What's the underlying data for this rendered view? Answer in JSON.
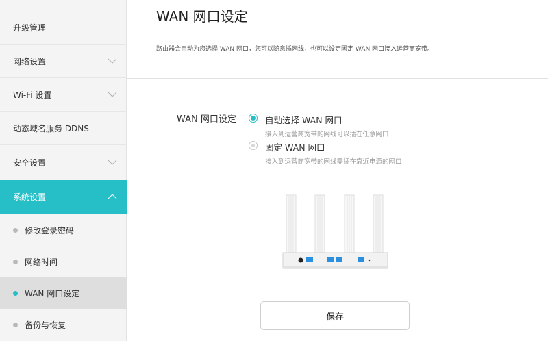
{
  "sidebar": {
    "items": [
      {
        "label": "升级管理"
      },
      {
        "label": "网络设置"
      },
      {
        "label": "Wi-Fi 设置"
      },
      {
        "label": "动态域名服务 DDNS"
      },
      {
        "label": "安全设置"
      },
      {
        "label": "系统设置"
      }
    ],
    "sub_items": [
      {
        "label": "修改登录密码"
      },
      {
        "label": "网络时间"
      },
      {
        "label": "WAN 网口设定"
      },
      {
        "label": "备份与恢复"
      }
    ]
  },
  "main": {
    "title": "WAN 网口设定",
    "description": "路由器会自动为您选择 WAN 网口，您可以随意插网线，也可以设定固定 WAN 网口接入运营商宽带。",
    "field_label": "WAN 网口设定",
    "options": [
      {
        "label": "自动选择 WAN 网口",
        "hint": "接入到运营商宽带的网线可以插在任意网口",
        "selected": true
      },
      {
        "label": "固定 WAN 网口",
        "hint": "接入到运营商宽带的网线需插在靠近电源的网口",
        "selected": false
      }
    ],
    "save_label": "保存"
  },
  "colors": {
    "accent": "#26bfc7",
    "port_blue": "#2b8fe0"
  }
}
